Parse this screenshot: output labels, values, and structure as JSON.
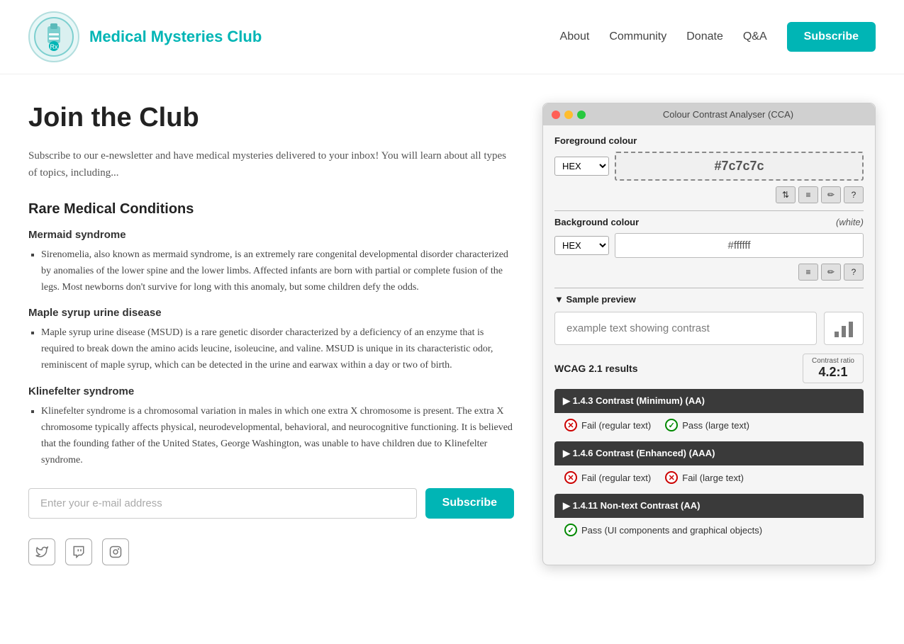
{
  "header": {
    "site_title": "Medical Mysteries Club",
    "nav": {
      "about": "About",
      "community": "Community",
      "donate": "Donate",
      "qa": "Q&A",
      "subscribe": "Subscribe"
    }
  },
  "content": {
    "page_title": "Join the Club",
    "page_desc": "Subscribe to our e-newsletter and have medical mysteries delivered to your inbox! You will learn about all types of topics, including...",
    "section_title": "Rare Medical Conditions",
    "conditions": [
      {
        "title": "Mermaid syndrome",
        "text": "Sirenomelia, also known as mermaid syndrome, is an extremely rare congenital developmental disorder characterized by anomalies of the lower spine and the lower limbs. Affected infants are born with partial or complete fusion of the legs. Most newborns don't survive for long with this anomaly, but some children defy the odds."
      },
      {
        "title": "Maple syrup urine disease",
        "text": "Maple syrup urine disease (MSUD) is a rare genetic disorder characterized by a deficiency of an enzyme that is required to break down the amino acids leucine, isoleucine, and valine. MSUD is unique in its characteristic odor, reminiscent of maple syrup, which can be detected in the urine and earwax within a day or two of birth."
      },
      {
        "title": "Klinefelter syndrome",
        "text": "Klinefelter syndrome is a chromosomal variation in males in which one extra X chromosome is present. The extra X chromosome typically affects physical, neurodevelopmental, behavioral, and neurocognitive functioning. It is believed that the founding father of the United States, George Washington, was unable to have children due to Klinefelter syndrome."
      }
    ],
    "email_placeholder": "Enter your e-mail address",
    "subscribe_btn": "Subscribe"
  },
  "cca": {
    "title": "Colour Contrast Analyser (CCA)",
    "foreground_label": "Foreground colour",
    "fg_format": "HEX",
    "fg_value": "#7c7c7c",
    "background_label": "Background colour",
    "bg_hint": "(white)",
    "bg_format": "HEX",
    "bg_value": "#ffffff",
    "sample_preview_label": "▼ Sample preview",
    "sample_preview_text": "example text showing contrast",
    "wcag_label": "WCAG 2.1 results",
    "contrast_ratio_label": "Contrast ratio",
    "contrast_ratio_value": "4.2:1",
    "wcag_items": [
      {
        "title": "▶ 1.4.3 Contrast (Minimum) (AA)",
        "results": [
          {
            "type": "fail",
            "label": "Fail (regular text)"
          },
          {
            "type": "pass",
            "label": "Pass (large text)"
          }
        ]
      },
      {
        "title": "▶ 1.4.6 Contrast (Enhanced) (AAA)",
        "results": [
          {
            "type": "fail",
            "label": "Fail (regular text)"
          },
          {
            "type": "fail",
            "label": "Fail (large text)"
          }
        ]
      },
      {
        "title": "▶ 1.4.11 Non-text Contrast (AA)",
        "results": [
          {
            "type": "pass",
            "label": "Pass (UI components and graphical objects)"
          }
        ]
      }
    ]
  },
  "social": {
    "icons": [
      "twitter",
      "twitch",
      "instagram"
    ]
  }
}
